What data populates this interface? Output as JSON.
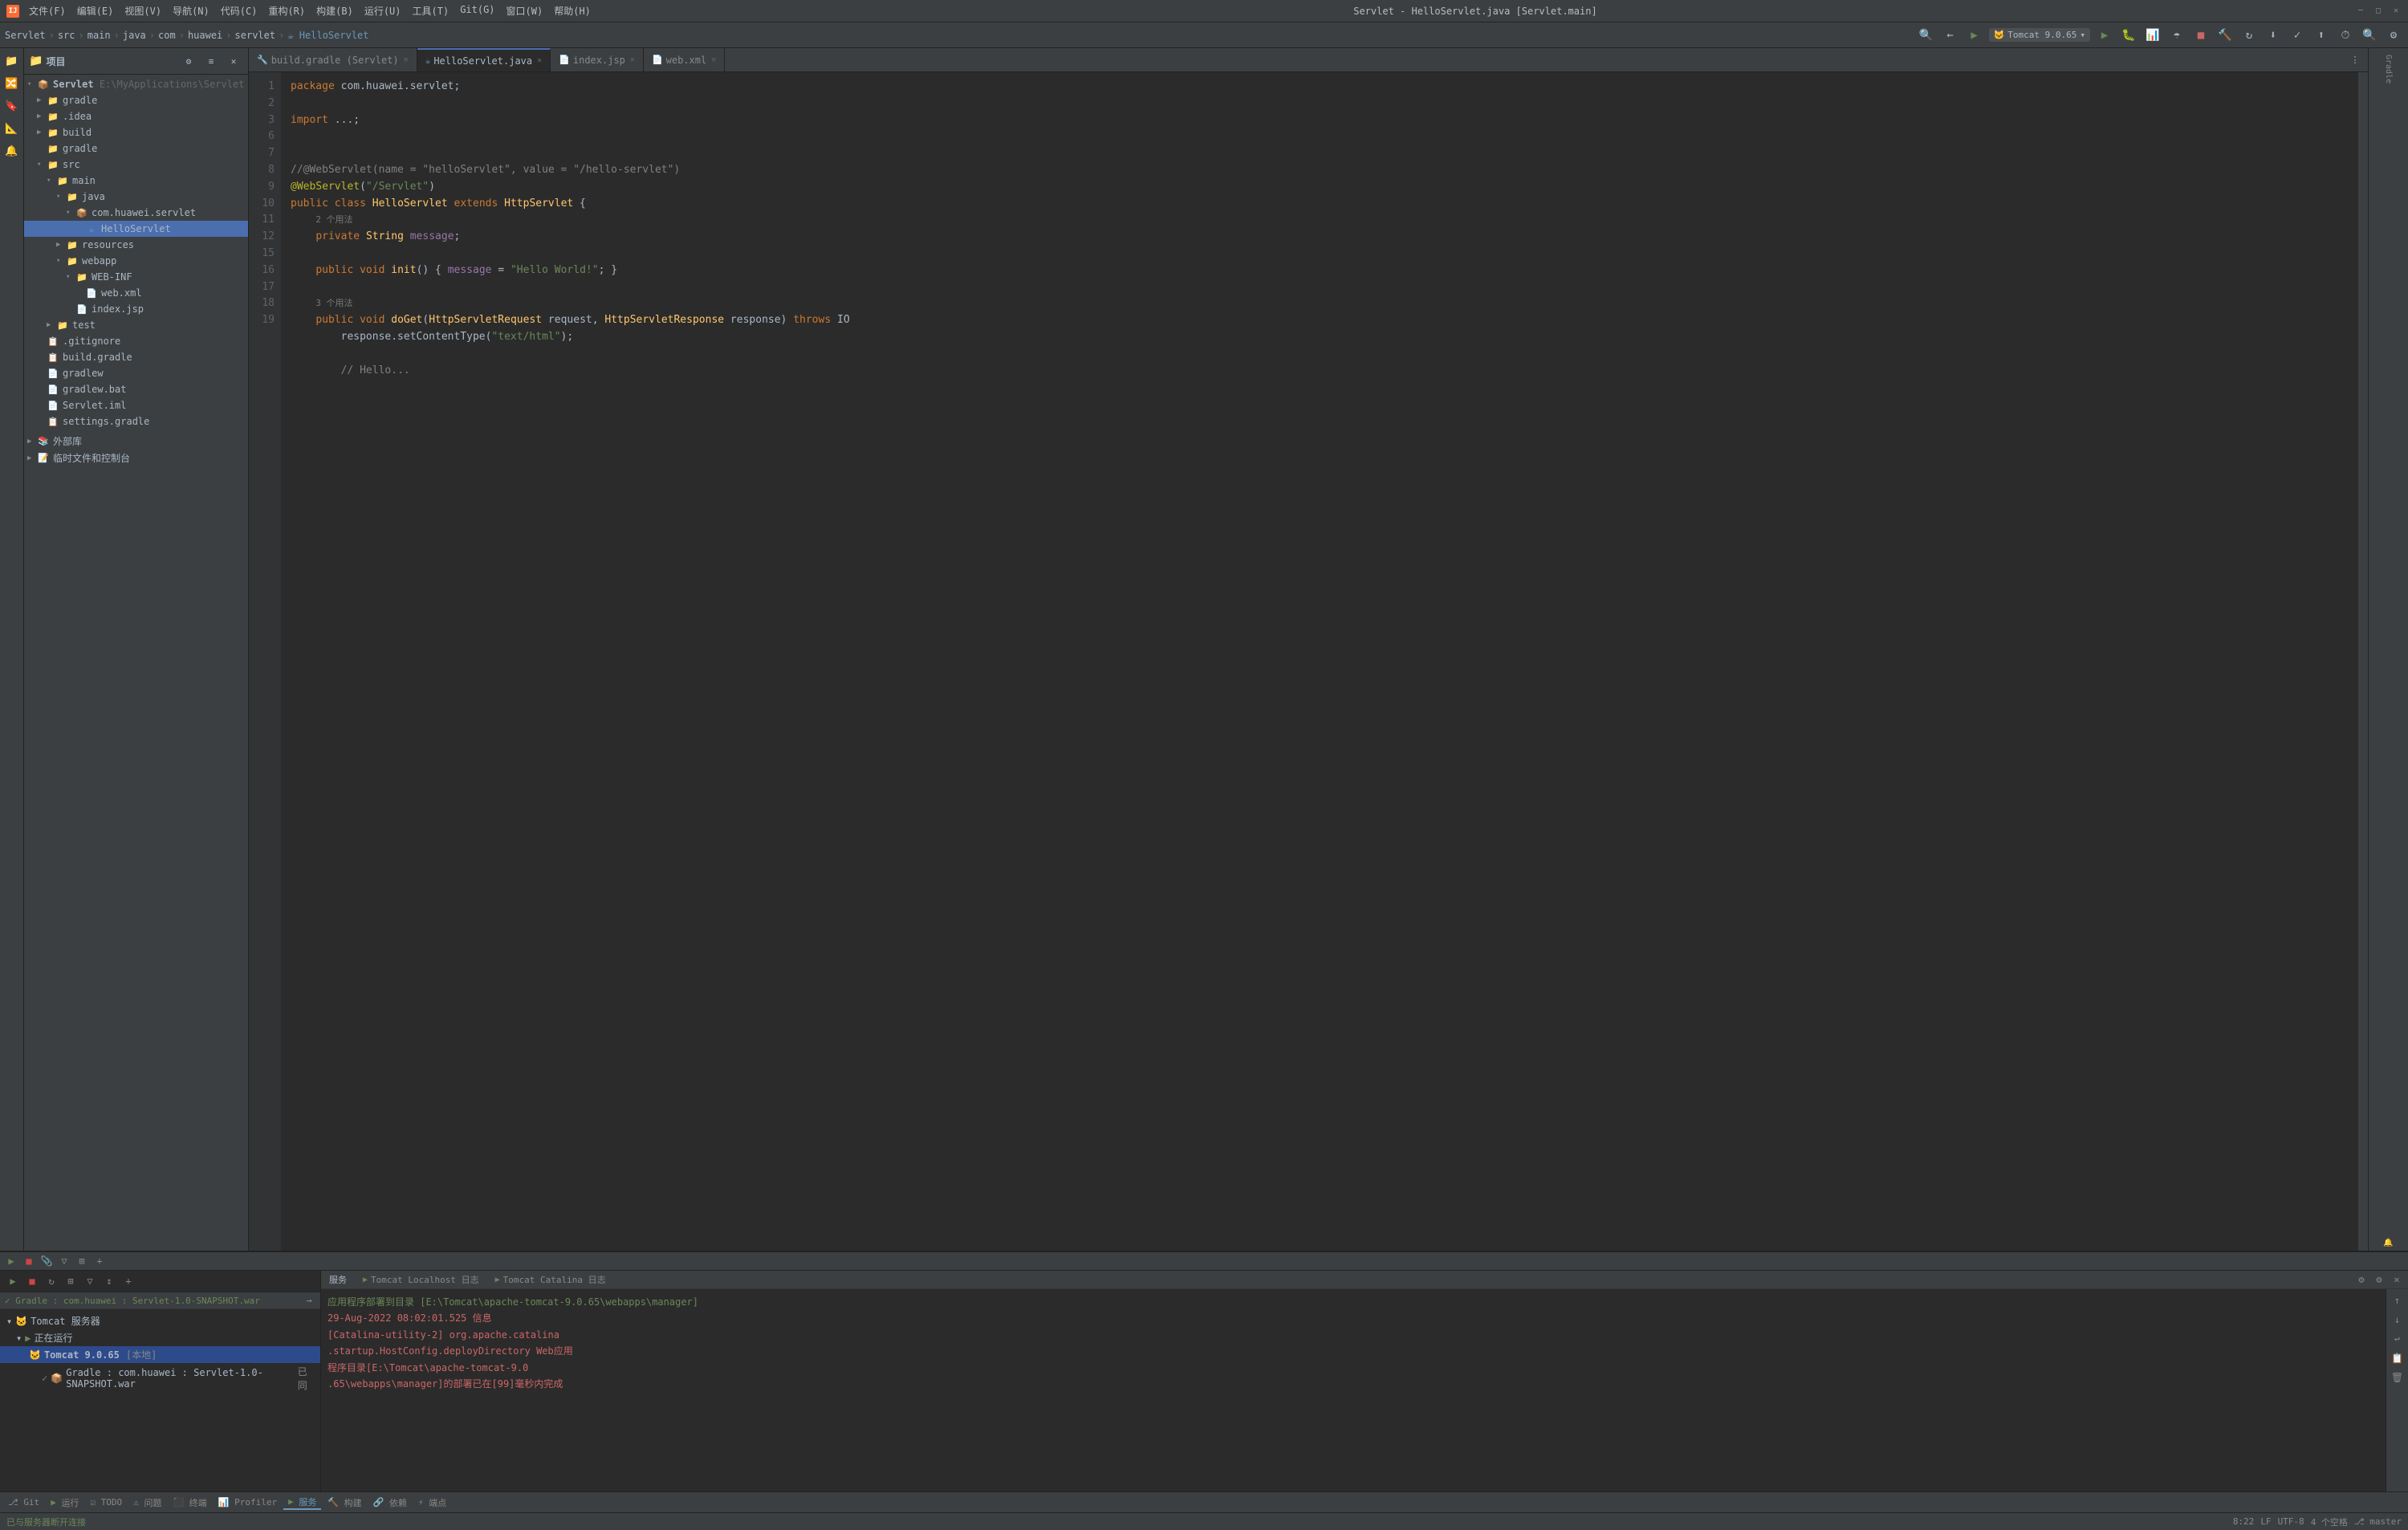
{
  "titlebar": {
    "title": "Servlet - HelloServlet.java [Servlet.main]",
    "app_label": "IJ"
  },
  "menubar": {
    "items": [
      "文件(F)",
      "编辑(E)",
      "视图(V)",
      "导航(N)",
      "代码(C)",
      "重构(R)",
      "构建(B)",
      "运行(U)",
      "工具(T)",
      "Git(G)",
      "窗口(W)",
      "帮助(H)"
    ]
  },
  "breadcrumb": {
    "items": [
      "Servlet",
      "src",
      "main",
      "java",
      "com",
      "huawei",
      "servlet",
      "HelloServlet"
    ]
  },
  "run_config": {
    "label": "Tomcat 9.0.65"
  },
  "tabs": [
    {
      "label": "build.gradle (Servlet)",
      "icon": "🔧",
      "active": false
    },
    {
      "label": "HelloServlet.java",
      "icon": "☕",
      "active": true
    },
    {
      "label": "index.jsp",
      "icon": "📄",
      "active": false
    },
    {
      "label": "web.xml",
      "icon": "📄",
      "active": false
    }
  ],
  "project": {
    "header": "项目",
    "tree": [
      {
        "level": 0,
        "label": "Servlet  E:\\MyApplications\\Servlet",
        "type": "project",
        "arrow": "▾",
        "selected": false
      },
      {
        "level": 1,
        "label": "gradle",
        "type": "folder",
        "arrow": "▶",
        "selected": false
      },
      {
        "level": 1,
        "label": ".idea",
        "type": "folder",
        "arrow": "▶",
        "selected": false
      },
      {
        "level": 1,
        "label": "build",
        "type": "folder",
        "arrow": "▶",
        "selected": false
      },
      {
        "level": 1,
        "label": "gradle",
        "type": "folder",
        "arrow": "",
        "selected": false
      },
      {
        "level": 1,
        "label": "src",
        "type": "folder",
        "arrow": "▾",
        "selected": false
      },
      {
        "level": 2,
        "label": "main",
        "type": "folder",
        "arrow": "▾",
        "selected": false
      },
      {
        "level": 3,
        "label": "java",
        "type": "folder",
        "arrow": "▾",
        "selected": false
      },
      {
        "level": 4,
        "label": "com.huawei.servlet",
        "type": "folder",
        "arrow": "▾",
        "selected": false
      },
      {
        "level": 5,
        "label": "HelloServlet",
        "type": "java",
        "arrow": "",
        "selected": true
      },
      {
        "level": 3,
        "label": "resources",
        "type": "folder",
        "arrow": "▶",
        "selected": false
      },
      {
        "level": 3,
        "label": "webapp",
        "type": "folder",
        "arrow": "▾",
        "selected": false
      },
      {
        "level": 4,
        "label": "WEB-INF",
        "type": "folder",
        "arrow": "▾",
        "selected": false
      },
      {
        "level": 5,
        "label": "web.xml",
        "type": "xml",
        "arrow": "",
        "selected": false
      },
      {
        "level": 4,
        "label": "index.jsp",
        "type": "jsp",
        "arrow": "",
        "selected": false
      },
      {
        "level": 2,
        "label": "test",
        "type": "folder",
        "arrow": "▶",
        "selected": false
      },
      {
        "level": 1,
        "label": ".gitignore",
        "type": "git",
        "arrow": "",
        "selected": false
      },
      {
        "level": 1,
        "label": "build.gradle",
        "type": "gradle",
        "arrow": "",
        "selected": false
      },
      {
        "level": 1,
        "label": "gradlew",
        "type": "file",
        "arrow": "",
        "selected": false
      },
      {
        "level": 1,
        "label": "gradlew.bat",
        "type": "file",
        "arrow": "",
        "selected": false
      },
      {
        "level": 1,
        "label": "Servlet.iml",
        "type": "iml",
        "arrow": "",
        "selected": false
      },
      {
        "level": 1,
        "label": "settings.gradle",
        "type": "gradle",
        "arrow": "",
        "selected": false
      }
    ]
  },
  "editor_sections": [
    {
      "label": "外部库",
      "arrow": "▶"
    },
    {
      "label": "临时文件和控制台",
      "arrow": "▶"
    }
  ],
  "code": {
    "lines": [
      {
        "num": 1,
        "content": "package com.huawei.servlet;"
      },
      {
        "num": 2,
        "content": ""
      },
      {
        "num": 3,
        "content": "import ...;"
      },
      {
        "num": 6,
        "content": ""
      },
      {
        "num": 7,
        "content": "//@WebServlet(name = \"helloServlet\", value = \"/hello-servlet\")"
      },
      {
        "num": 8,
        "content": "@WebServlet(\"/Servlet\")"
      },
      {
        "num": 9,
        "content": "public class HelloServlet extends HttpServlet {"
      },
      {
        "num": 10,
        "content": "    2 个用法"
      },
      {
        "num": "",
        "content": "    private String message;"
      },
      {
        "num": 11,
        "content": ""
      },
      {
        "num": 12,
        "content": "    public void init() { message = \"Hello World!\"; }"
      },
      {
        "num": 15,
        "content": ""
      },
      {
        "num": "",
        "content": "    3 个用法"
      },
      {
        "num": 16,
        "content": "    public void doGet(HttpServletRequest request, HttpServletResponse response) throws IO"
      },
      {
        "num": 17,
        "content": "        response.setContentType(\"text/html\");"
      },
      {
        "num": 18,
        "content": ""
      },
      {
        "num": 19,
        "content": "        // Hello..."
      }
    ]
  },
  "bottom_panel": {
    "title": "服务",
    "tabs": [
      "服务",
      "Tomcat Localhost 日志",
      "Tomcat Catalina 日志"
    ],
    "active_tab": 0,
    "services_tree": [
      {
        "label": "Tomcat 服务器",
        "level": 0,
        "arrow": "▾",
        "icon": "▾"
      },
      {
        "label": "正在运行",
        "level": 1,
        "arrow": "▾",
        "running": true
      },
      {
        "label": "Tomcat 9.0.65  [本地]",
        "level": 2,
        "highlight": true
      },
      {
        "label": "Gradle : com.huawei : Servlet-1.0-SNAPSHOT.war  已同",
        "level": 3
      }
    ],
    "deploy_file": "Gradle : com.huawei : Servlet-1.0-SNAPSHOT.war",
    "log_lines": [
      {
        "text": "应用程序部署到目录 [E:\\Tomcat\\apache-tomcat-9.0.65\\webapps\\manager]",
        "color": "green"
      },
      {
        "text": "29-Aug-2022 08:02:01.525 信息 [Catalina-utility-2] org.apache.catalina.startup.HostConfig.deployDirectory Web应用程序目录[E:\\Tomcat\\apache-tomcat-9.0.65\\webapps\\manager]的部署已在[99]毫秒内完成",
        "color": "red"
      }
    ]
  },
  "status_bar": {
    "left": "已与服务器断开连接",
    "position": "8:22",
    "encoding": "UTF-8",
    "line_sep": "LF",
    "indent": "4 个空格",
    "branch": "master"
  },
  "bottom_nav": {
    "items": [
      "Git",
      "运行",
      "TODO",
      "问题",
      "终端",
      "Profiler",
      "服务",
      "构建",
      "依赖",
      "端点"
    ]
  }
}
